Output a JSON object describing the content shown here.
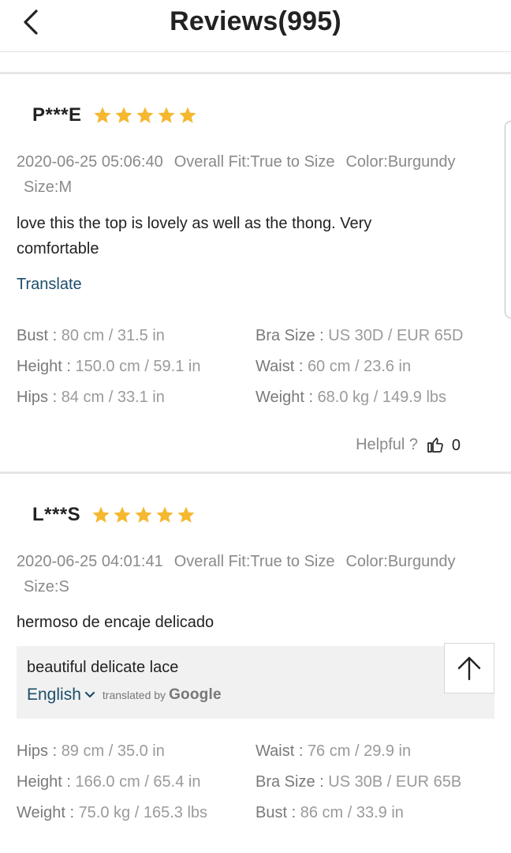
{
  "header": {
    "title": "Reviews(995)",
    "back_icon": "chevron-left-icon"
  },
  "reviews": [
    {
      "username": "P***E",
      "rating": 5,
      "date": "2020-06-25 05:06:40",
      "overall_fit": "Overall Fit:True to Size",
      "color": "Color:Burgundy",
      "size": "Size:M",
      "comment": "love this the top is lovely as well as the thong. Very comfortable",
      "translate_label": "Translate",
      "measurements": [
        {
          "left_label": "Bust :",
          "left_value": "80 cm / 31.5 in",
          "right_label": "Bra Size :",
          "right_value": "US 30D / EUR 65D"
        },
        {
          "left_label": "Height :",
          "left_value": "150.0 cm / 59.1 in",
          "right_label": "Waist :",
          "right_value": "60 cm / 23.6 in"
        },
        {
          "left_label": "Hips :",
          "left_value": "84 cm / 33.1 in",
          "right_label": "Weight :",
          "right_value": "68.0 kg / 149.9 lbs"
        }
      ],
      "helpful_label": "Helpful ?",
      "helpful_count": "0"
    },
    {
      "username": "L***S",
      "rating": 5,
      "date": "2020-06-25 04:01:41",
      "overall_fit": "Overall Fit:True to Size",
      "color": "Color:Burgundy",
      "size": "Size:S",
      "comment": "hermoso de encaje delicado",
      "translation": {
        "text": "beautiful delicate lace",
        "language": "English",
        "translated_by": "translated by",
        "provider": "Google"
      },
      "measurements": [
        {
          "left_label": "Hips :",
          "left_value": "89 cm / 35.0 in",
          "right_label": "Waist :",
          "right_value": "76 cm / 29.9 in"
        },
        {
          "left_label": "Height :",
          "left_value": "166.0 cm / 65.4 in",
          "right_label": "Bra Size :",
          "right_value": "US 30B / EUR 65B"
        },
        {
          "left_label": "Weight :",
          "left_value": "75.0 kg / 165.3 lbs",
          "right_label": "Bust :",
          "right_value": "86 cm / 33.9 in"
        }
      ]
    }
  ],
  "scroll_top_icon": "arrow-up-icon",
  "colors": {
    "star": "#F5B82E",
    "link": "#1D4E6B",
    "muted_text": "#8A8A8A"
  }
}
